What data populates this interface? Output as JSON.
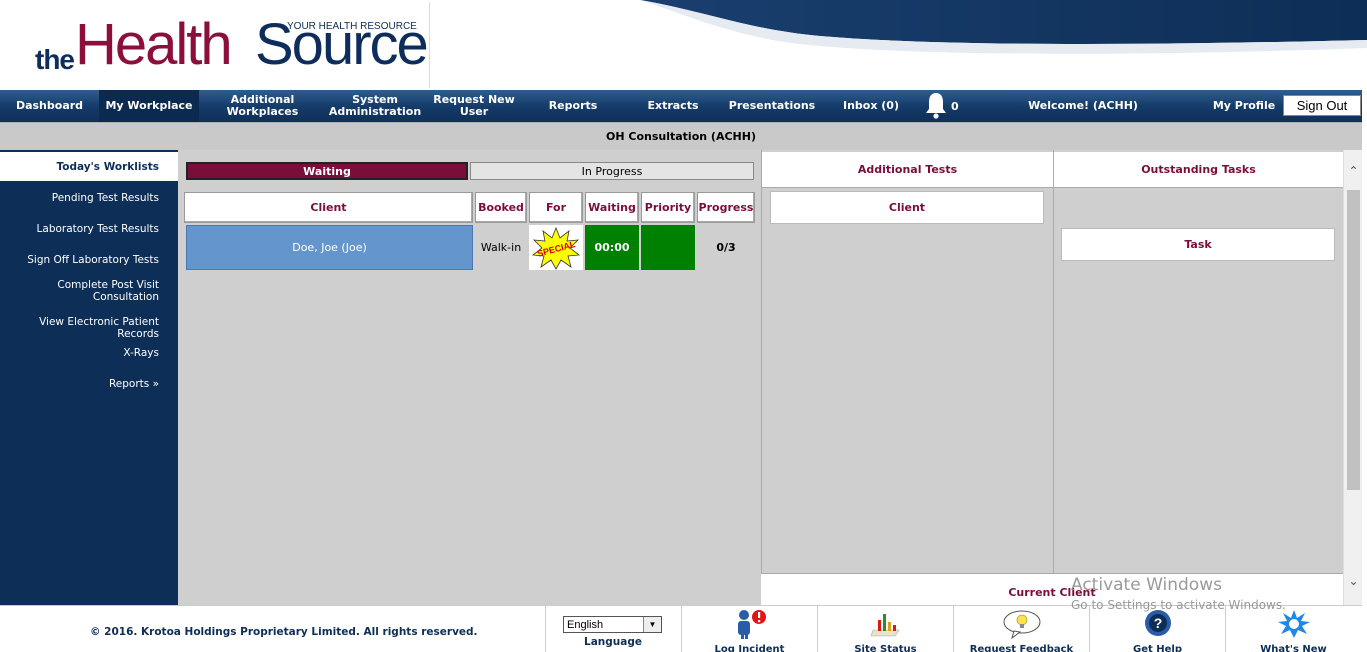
{
  "logo": {
    "the": "the",
    "health": "Health",
    "source": "Source",
    "tagline": "YOUR HEALTH RESOURCE"
  },
  "nav": {
    "items": [
      {
        "label": "Dashboard"
      },
      {
        "label": "My Workplace",
        "active": true
      },
      {
        "label": "Additional Workplaces"
      },
      {
        "label": "System Administration"
      },
      {
        "label": "Request New User"
      },
      {
        "label": "Reports"
      },
      {
        "label": "Extracts"
      },
      {
        "label": "Presentations"
      },
      {
        "label": "Inbox (0)"
      }
    ],
    "notification_count": "0",
    "welcome": "Welcome! (ACHH)",
    "my_profile": "My Profile",
    "sign_out": "Sign Out"
  },
  "page_title": "OH Consultation (ACHH)",
  "sidebar": {
    "items": [
      {
        "label": "Today's Worklists",
        "active": true
      },
      {
        "label": "Pending Test Results"
      },
      {
        "label": "Laboratory Test Results"
      },
      {
        "label": "Sign Off Laboratory Tests"
      },
      {
        "label": "Complete Post Visit Consultation"
      },
      {
        "label": "View Electronic Patient Records"
      },
      {
        "label": "X-Rays"
      },
      {
        "label": "Reports »"
      }
    ]
  },
  "worklist": {
    "tabs": {
      "waiting": "Waiting",
      "in_progress": "In Progress"
    },
    "columns": [
      "Client",
      "Booked",
      "For",
      "Waiting",
      "Priority",
      "Progress"
    ],
    "rows": [
      {
        "client": "Doe, Joe (Joe)",
        "booked": "Walk-in",
        "for_badge": "SPECIAL",
        "waiting": "00:00",
        "priority": "",
        "progress": "0/3"
      }
    ]
  },
  "additional_tests": {
    "title": "Additional Tests",
    "client_label": "Client"
  },
  "outstanding_tasks": {
    "title": "Outstanding Tasks",
    "task_label": "Task"
  },
  "current_client": "Current Client",
  "footer": {
    "copyright": "© 2016. Krotoa Holdings Proprietary Limited. All rights reserved.",
    "language_value": "English",
    "language_label": "Language",
    "tools": [
      {
        "icon": "log-incident-icon",
        "label": "Log Incident"
      },
      {
        "icon": "site-status-icon",
        "label": "Site Status"
      },
      {
        "icon": "request-feedback-icon",
        "label": "Request Feedback"
      },
      {
        "icon": "get-help-icon",
        "label": "Get Help"
      },
      {
        "icon": "whats-new-icon",
        "label": "What's New"
      }
    ]
  },
  "watermark": {
    "line1": "Activate Windows",
    "line2": "Go to Settings to activate Windows."
  },
  "colors": {
    "navy": "#0d2e56",
    "maroon": "#7b0d3a",
    "client_cell": "#6495cd",
    "green": "#008000"
  }
}
